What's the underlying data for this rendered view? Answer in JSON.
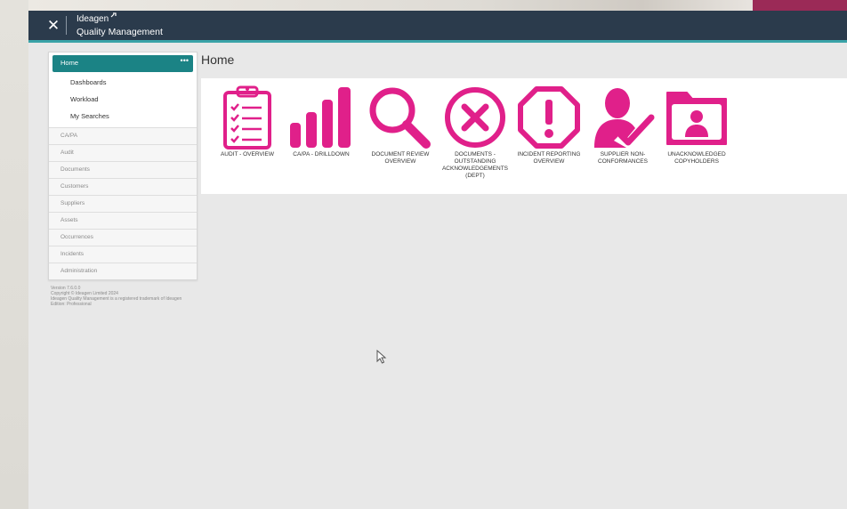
{
  "header": {
    "brand": "Ideagen",
    "product": "Quality Management",
    "close_glyph": "✕"
  },
  "sidebar": {
    "home": {
      "label": "Home",
      "more": "•••"
    },
    "sub_items": [
      {
        "label": "Dashboards"
      },
      {
        "label": "Workload"
      },
      {
        "label": "My Searches"
      }
    ],
    "items": [
      {
        "label": "CA/PA"
      },
      {
        "label": "Audit"
      },
      {
        "label": "Documents"
      },
      {
        "label": "Customers"
      },
      {
        "label": "Suppliers"
      },
      {
        "label": "Assets"
      },
      {
        "label": "Occurrences"
      },
      {
        "label": "Incidents"
      },
      {
        "label": "Administration"
      }
    ]
  },
  "footer": {
    "version": "Version 7.6.0.0",
    "copyright": "Copyright © Ideagen Limited 2024",
    "trademark": "Ideagen Quality Management is a registered trademark of Ideagen",
    "edition": "Edition: Professional"
  },
  "main": {
    "title": "Home",
    "tiles": [
      {
        "label": "AUDIT - OVERVIEW",
        "icon": "clipboard-checklist-icon"
      },
      {
        "label": "CA/PA - DRILLDOWN",
        "icon": "bar-chart-icon"
      },
      {
        "label": "DOCUMENT REVIEW OVERVIEW",
        "icon": "magnifier-icon"
      },
      {
        "label": "DOCUMENTS - OUTSTANDING ACKNOWLEDGEMENTS (DEPT)",
        "icon": "circle-x-icon"
      },
      {
        "label": "INCIDENT REPORTING OVERVIEW",
        "icon": "octagon-alert-icon"
      },
      {
        "label": "SUPPLIER NON-CONFORMANCES",
        "icon": "person-check-icon"
      },
      {
        "label": "UNACKNOWLEDGED COPYHOLDERS",
        "icon": "folder-person-icon"
      }
    ]
  },
  "colors": {
    "accent": "#e0208a",
    "header": "#2b3b4c",
    "teal": "#1b8385"
  }
}
